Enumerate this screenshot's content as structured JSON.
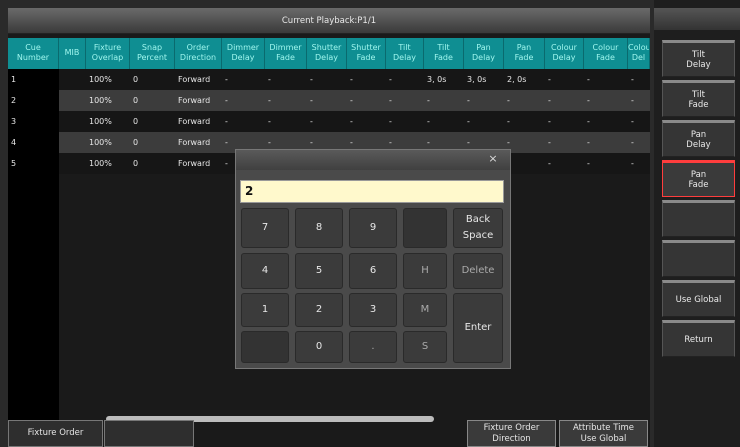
{
  "title": "Current Playback:P1/1",
  "columns": [
    [
      "Cue",
      "Number"
    ],
    [
      "MIB",
      ""
    ],
    [
      "Fixture",
      "Overlap"
    ],
    [
      "Snap",
      "Percent"
    ],
    [
      "Order",
      "Direction"
    ],
    [
      "Dimmer",
      "Delay"
    ],
    [
      "Dimmer",
      "Fade"
    ],
    [
      "Shutter",
      "Delay"
    ],
    [
      "Shutter",
      "Fade"
    ],
    [
      "Tilt",
      "Delay"
    ],
    [
      "Tilt",
      "Fade"
    ],
    [
      "Pan",
      "Delay"
    ],
    [
      "Pan",
      "Fade"
    ],
    [
      "Colour",
      "Delay"
    ],
    [
      "Colour",
      "Fade"
    ],
    [
      "Colou",
      "Del"
    ]
  ],
  "rows": [
    [
      "1",
      "",
      "100%",
      "0",
      "Forward",
      "-",
      "-",
      "-",
      "-",
      "-",
      "3, 0s",
      "3, 0s",
      "2, 0s",
      "-",
      "-",
      "-"
    ],
    [
      "2",
      "",
      "100%",
      "0",
      "Forward",
      "-",
      "-",
      "-",
      "-",
      "-",
      "-",
      "-",
      "-",
      "-",
      "-",
      "-"
    ],
    [
      "3",
      "",
      "100%",
      "0",
      "Forward",
      "-",
      "-",
      "-",
      "-",
      "-",
      "-",
      "-",
      "-",
      "-",
      "-",
      "-"
    ],
    [
      "4",
      "",
      "100%",
      "0",
      "Forward",
      "-",
      "-",
      "-",
      "-",
      "-",
      "-",
      "-",
      "-",
      "-",
      "-",
      "-"
    ],
    [
      "5",
      "",
      "100%",
      "0",
      "Forward",
      "-",
      "",
      "",
      "",
      "",
      "",
      "",
      "",
      "-",
      "-",
      "-"
    ]
  ],
  "bottom_buttons": {
    "fixture_order": "Fixture Order",
    "blank": "",
    "fixture_order_direction": [
      "Fixture Order",
      "Direction"
    ],
    "attribute_time": [
      "Attribute Time",
      "Use Global"
    ]
  },
  "sidebar": {
    "buttons": [
      [
        "Tilt",
        "Delay"
      ],
      [
        "Tilt",
        "Fade"
      ],
      [
        "Pan",
        "Delay"
      ],
      [
        "Pan",
        "Fade"
      ],
      [
        "",
        ""
      ],
      [
        "",
        ""
      ],
      [
        "Use Global",
        ""
      ],
      [
        "Return",
        ""
      ]
    ],
    "active_index": 3
  },
  "dialog": {
    "close": "×",
    "input_value": "2",
    "keys": {
      "k7": "7",
      "k8": "8",
      "k9": "9",
      "back": [
        "Back",
        "Space"
      ],
      "k4": "4",
      "k5": "5",
      "k6": "6",
      "h": "H",
      "delete": "Delete",
      "k1": "1",
      "k2": "2",
      "k3": "3",
      "m": "M",
      "enter": "Enter",
      "k0": "0",
      "dot": ".",
      "s": "S"
    }
  },
  "colors": {
    "header_bg": "#0f8e92",
    "header_text": "#9ff6ee",
    "input_bg": "#fff9cc",
    "active_border": "#ff3d3d"
  }
}
